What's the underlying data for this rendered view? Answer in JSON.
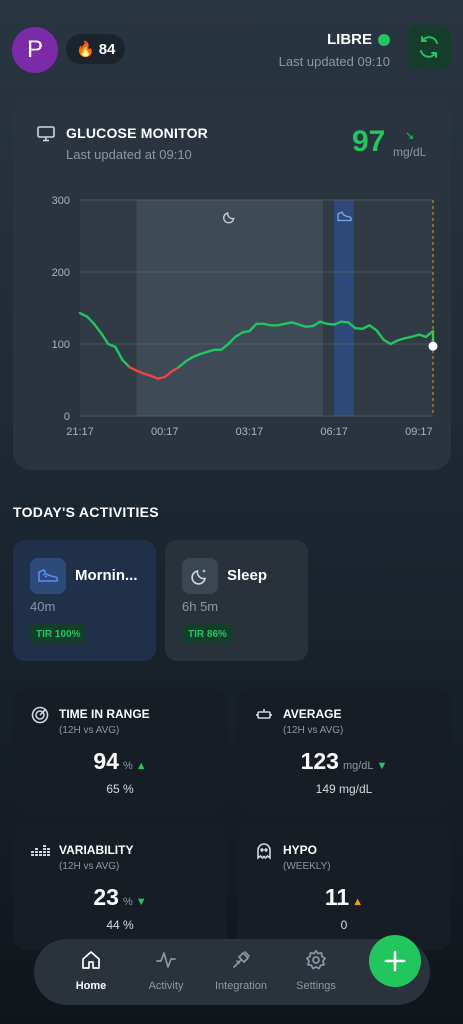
{
  "header": {
    "avatar_letter": "P",
    "streak_icon": "flame-icon",
    "streak_count": "84",
    "device_name": "LIBRE",
    "device_status_color": "#22c55e",
    "last_updated": "Last updated 09:10",
    "sync_icon": "sync-icon"
  },
  "glucose": {
    "title": "GLUCOSE MONITOR",
    "subtitle": "Last updated at 09:10",
    "value": "97",
    "trend_arrow": "↘",
    "unit": "mg/dL"
  },
  "chart_data": {
    "type": "line",
    "y_ticks": [
      "300",
      "200",
      "100",
      "0"
    ],
    "x_ticks": [
      "21:17",
      "00:17",
      "03:17",
      "06:17",
      "09:17"
    ],
    "ylim": [
      0,
      300
    ],
    "xlim_hours": [
      0,
      12.5
    ],
    "grid": true,
    "series": [
      {
        "x": [
          0,
          0.25,
          0.5,
          0.75,
          1.0,
          1.25,
          1.5,
          1.75,
          2.0,
          2.25,
          2.5,
          2.75,
          3.0,
          3.25,
          3.5,
          3.75,
          4.0,
          4.25,
          4.5,
          4.75,
          5.0,
          5.25,
          5.5,
          5.75,
          6.0,
          6.25,
          6.5,
          6.75,
          7.0,
          7.25,
          7.5,
          7.75,
          8.0,
          8.25,
          8.5,
          8.75,
          9.0,
          9.25,
          9.5,
          9.75,
          10.0,
          10.25,
          10.5,
          10.75,
          11.0,
          11.25,
          11.5,
          11.75,
          12.0,
          12.25,
          12.5
        ],
        "y": [
          143,
          138,
          128,
          115,
          100,
          96,
          78,
          68,
          63,
          59,
          56,
          52,
          54,
          62,
          68,
          76,
          82,
          86,
          89,
          92,
          92,
          100,
          110,
          116,
          118,
          128,
          128,
          126,
          126,
          128,
          130,
          127,
          124,
          125,
          131,
          128,
          127,
          131,
          130,
          122,
          121,
          126,
          119,
          106,
          100,
          105,
          108,
          110,
          113,
          110,
          118
        ]
      }
    ],
    "low_threshold": 70,
    "low_color": "#ef4444",
    "line_color": "#22c55e",
    "sleep_band_hours": [
      2.0,
      8.6
    ],
    "activity_band_hours": [
      9.0,
      9.7
    ],
    "current_value": 97,
    "sleep_icon": "moon-icon",
    "activity_icon": "shoe-icon"
  },
  "activities": {
    "title": "TODAY'S ACTIVITIES",
    "items": [
      {
        "name": "Mornin...",
        "duration": "40m",
        "tir": "TIR 100%",
        "icon": "shoe-icon"
      },
      {
        "name": "Sleep",
        "duration": "6h 5m",
        "tir": "TIR 86%",
        "icon": "moon-icon"
      }
    ]
  },
  "stats": {
    "tir": {
      "title": "TIME IN RANGE",
      "sub": "(12H vs AVG)",
      "value": "94",
      "unit": "%",
      "trend": "▲",
      "avg": "65 %",
      "icon": "target-icon"
    },
    "average": {
      "title": "AVERAGE",
      "sub": "(12H vs AVG)",
      "value": "123",
      "unit": "mg/dL",
      "trend": "▼",
      "avg": "149 mg/dL",
      "icon": "range-icon"
    },
    "variability": {
      "title": "VARIABILITY",
      "sub": "(12H vs AVG)",
      "value": "23",
      "unit": "%",
      "trend": "▼",
      "avg": "44 %",
      "icon": "bars-icon"
    },
    "hypo": {
      "title": "HYPO",
      "sub": "(WEEKLY)",
      "value": "11",
      "unit": "",
      "trend": "▲",
      "avg": "0",
      "icon": "ghost-icon"
    }
  },
  "nav": {
    "items": [
      {
        "label": "Home",
        "icon": "home-icon"
      },
      {
        "label": "Activity",
        "icon": "activity-icon"
      },
      {
        "label": "Integration",
        "icon": "plug-icon"
      },
      {
        "label": "Settings",
        "icon": "gear-icon"
      }
    ],
    "fab_icon": "plus-icon"
  },
  "colors": {
    "accent": "#22c55e",
    "low": "#ef4444",
    "warning": "#f59e0b",
    "card": "#2a343f",
    "activity_blue": "#2e4a78"
  }
}
